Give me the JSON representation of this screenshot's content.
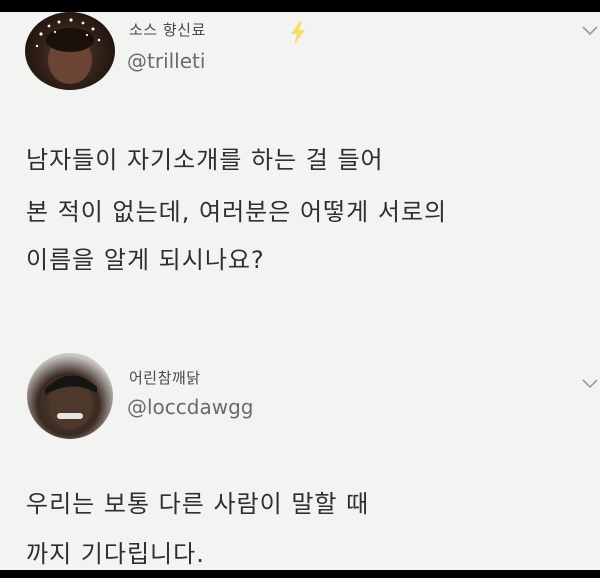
{
  "tweets": [
    {
      "display_name": "소스 향신료",
      "handle": "@trilleti",
      "avatar_icon": "profile-photo",
      "decoration_icon": "lightning-bolt-icon",
      "menu_icon": "chevron-down-icon",
      "body_lines": [
        "남자들이 자기소개를 하는 걸 들어",
        "본 적이 없는데, 여러분은 어떻게 서로의",
        "이름을 알게 되시나요?"
      ]
    },
    {
      "display_name": "어린참깨닭",
      "handle": "@loccdawgg",
      "avatar_icon": "profile-photo",
      "menu_icon": "chevron-down-icon",
      "body_lines": [
        "우리는 보통 다른 사람이 말할 때",
        "까지 기다립니다."
      ]
    }
  ],
  "colors": {
    "background": "#f3f3f2",
    "frame": "#000000",
    "text_primary": "#2f2f2f",
    "text_secondary": "#6b6b6b",
    "accent_bolt": "#f2d94e"
  }
}
